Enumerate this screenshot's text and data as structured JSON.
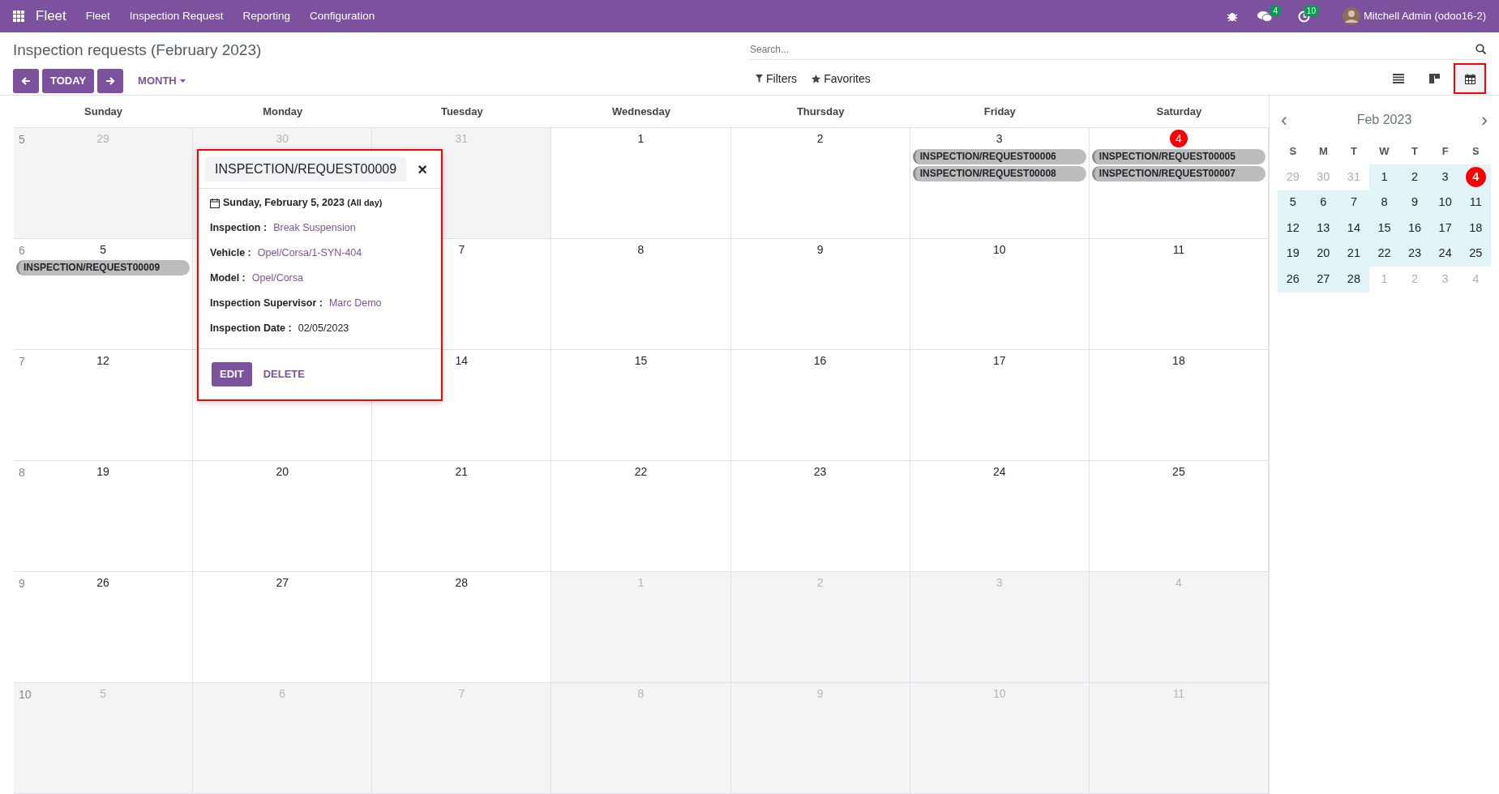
{
  "navbar": {
    "app_name": "Fleet",
    "menu": [
      "Fleet",
      "Inspection Request",
      "Reporting",
      "Configuration"
    ],
    "messages_badge": "4",
    "activities_badge": "10",
    "user": "Mitchell Admin (odoo16-2)"
  },
  "control_panel": {
    "title": "Inspection requests (February 2023)",
    "today_button": "TODAY",
    "scale_dropdown": "MONTH",
    "search_placeholder": "Search...",
    "filters": "Filters",
    "favorites": "Favorites",
    "views": [
      {
        "kind": "list",
        "selected": false,
        "outlined": false
      },
      {
        "kind": "kanban",
        "selected": false,
        "outlined": false
      },
      {
        "kind": "calendar",
        "selected": true,
        "outlined": true
      }
    ]
  },
  "calendar": {
    "weekdays": [
      "Sunday",
      "Monday",
      "Tuesday",
      "Wednesday",
      "Thursday",
      "Friday",
      "Saturday"
    ],
    "weeks": [
      {
        "number": "5",
        "days": [
          {
            "label": "29",
            "in_month": false,
            "today": false
          },
          {
            "label": "30",
            "in_month": false,
            "today": false
          },
          {
            "label": "31",
            "in_month": false,
            "today": false
          },
          {
            "label": "1",
            "in_month": true,
            "today": false
          },
          {
            "label": "2",
            "in_month": true,
            "today": false
          },
          {
            "label": "3",
            "in_month": true,
            "today": false,
            "events": [
              "INSPECTION/REQUEST00006",
              "INSPECTION/REQUEST00008"
            ]
          },
          {
            "label": "4",
            "in_month": true,
            "today": true,
            "events": [
              "INSPECTION/REQUEST00005",
              "INSPECTION/REQUEST00007"
            ]
          }
        ]
      },
      {
        "number": "6",
        "days": [
          {
            "label": "5",
            "in_month": true,
            "today": false,
            "events": [
              "INSPECTION/REQUEST00009"
            ]
          },
          {
            "in_month": true
          },
          {
            "label": "7",
            "in_month": true,
            "today": false
          },
          {
            "label": "8",
            "in_month": true,
            "today": false
          },
          {
            "label": "9",
            "in_month": true,
            "today": false
          },
          {
            "label": "10",
            "in_month": true,
            "today": false
          },
          {
            "label": "11",
            "in_month": true,
            "today": false
          }
        ]
      },
      {
        "number": "7",
        "days": [
          {
            "label": "12",
            "in_month": true,
            "today": false
          },
          {
            "in_month": true
          },
          {
            "label": "14",
            "in_month": true,
            "today": false
          },
          {
            "label": "15",
            "in_month": true,
            "today": false
          },
          {
            "label": "16",
            "in_month": true,
            "today": false
          },
          {
            "label": "17",
            "in_month": true,
            "today": false
          },
          {
            "label": "18",
            "in_month": true,
            "today": false
          }
        ]
      },
      {
        "number": "8",
        "days": [
          {
            "label": "19",
            "in_month": true,
            "today": false
          },
          {
            "label": "20",
            "in_month": true,
            "today": false
          },
          {
            "label": "21",
            "in_month": true,
            "today": false
          },
          {
            "label": "22",
            "in_month": true,
            "today": false
          },
          {
            "label": "23",
            "in_month": true,
            "today": false
          },
          {
            "label": "24",
            "in_month": true,
            "today": false
          },
          {
            "label": "25",
            "in_month": true,
            "today": false
          }
        ]
      },
      {
        "number": "9",
        "days": [
          {
            "label": "26",
            "in_month": true,
            "today": false
          },
          {
            "label": "27",
            "in_month": true,
            "today": false
          },
          {
            "label": "28",
            "in_month": true,
            "today": false
          },
          {
            "label": "1",
            "in_month": false,
            "today": false
          },
          {
            "label": "2",
            "in_month": false,
            "today": false
          },
          {
            "label": "3",
            "in_month": false,
            "today": false
          },
          {
            "label": "4",
            "in_month": false,
            "today": false
          }
        ]
      },
      {
        "number": "10",
        "days": [
          {
            "label": "5",
            "in_month": false,
            "today": false
          },
          {
            "label": "6",
            "in_month": false,
            "today": false
          },
          {
            "label": "7",
            "in_month": false,
            "today": false
          },
          {
            "label": "8",
            "in_month": false,
            "today": false
          },
          {
            "label": "9",
            "in_month": false,
            "today": false
          },
          {
            "label": "10",
            "in_month": false,
            "today": false
          },
          {
            "label": "11",
            "in_month": false,
            "today": false
          }
        ]
      }
    ]
  },
  "popover": {
    "title": "INSPECTION/REQUEST00009",
    "close": "×",
    "outlined": true,
    "date": "Sunday, February 5, 2023",
    "date_note": "(All day)",
    "fields": [
      {
        "label": "Inspection :",
        "value": "Break Suspension",
        "link": true
      },
      {
        "label": "Vehicle :",
        "value": "Opel/Corsa/1-SYN-404",
        "link": true
      },
      {
        "label": "Model :",
        "value": "Opel/Corsa",
        "link": true
      },
      {
        "label": "Inspection Supervisor :",
        "value": "Marc Demo",
        "link": true
      },
      {
        "label": "Inspection Date :",
        "value": "02/05/2023",
        "link": false
      }
    ],
    "buttons": [
      "EDIT",
      "DELETE"
    ]
  },
  "mini_calendar": {
    "title": "Feb 2023",
    "prev": "‹",
    "next": "›",
    "weekdays": [
      "S",
      "M",
      "T",
      "W",
      "T",
      "F",
      "S"
    ],
    "weeks": [
      [
        {
          "label": "29",
          "in_month": false,
          "today": false
        },
        {
          "label": "30",
          "in_month": false,
          "today": false
        },
        {
          "label": "31",
          "in_month": false,
          "today": false
        },
        {
          "label": "1",
          "in_month": true,
          "today": false
        },
        {
          "label": "2",
          "in_month": true,
          "today": false
        },
        {
          "label": "3",
          "in_month": true,
          "today": false
        },
        {
          "label": "4",
          "in_month": true,
          "today": true
        }
      ],
      [
        {
          "label": "5",
          "in_month": true,
          "today": false
        },
        {
          "label": "6",
          "in_month": true,
          "today": false
        },
        {
          "label": "7",
          "in_month": true,
          "today": false
        },
        {
          "label": "8",
          "in_month": true,
          "today": false
        },
        {
          "label": "9",
          "in_month": true,
          "today": false
        },
        {
          "label": "10",
          "in_month": true,
          "today": false
        },
        {
          "label": "11",
          "in_month": true,
          "today": false
        }
      ],
      [
        {
          "label": "12",
          "in_month": true,
          "today": false
        },
        {
          "label": "13",
          "in_month": true,
          "today": false
        },
        {
          "label": "14",
          "in_month": true,
          "today": false
        },
        {
          "label": "15",
          "in_month": true,
          "today": false
        },
        {
          "label": "16",
          "in_month": true,
          "today": false
        },
        {
          "label": "17",
          "in_month": true,
          "today": false
        },
        {
          "label": "18",
          "in_month": true,
          "today": false
        }
      ],
      [
        {
          "label": "19",
          "in_month": true,
          "today": false
        },
        {
          "label": "20",
          "in_month": true,
          "today": false
        },
        {
          "label": "21",
          "in_month": true,
          "today": false
        },
        {
          "label": "22",
          "in_month": true,
          "today": false
        },
        {
          "label": "23",
          "in_month": true,
          "today": false
        },
        {
          "label": "24",
          "in_month": true,
          "today": false
        },
        {
          "label": "25",
          "in_month": true,
          "today": false
        }
      ],
      [
        {
          "label": "26",
          "in_month": true,
          "today": false
        },
        {
          "label": "27",
          "in_month": true,
          "today": false
        },
        {
          "label": "28",
          "in_month": true,
          "today": false
        },
        {
          "label": "1",
          "in_month": false,
          "today": false
        },
        {
          "label": "2",
          "in_month": false,
          "today": false
        },
        {
          "label": "3",
          "in_month": false,
          "today": false
        },
        {
          "label": "4",
          "in_month": false,
          "today": false
        }
      ]
    ]
  }
}
